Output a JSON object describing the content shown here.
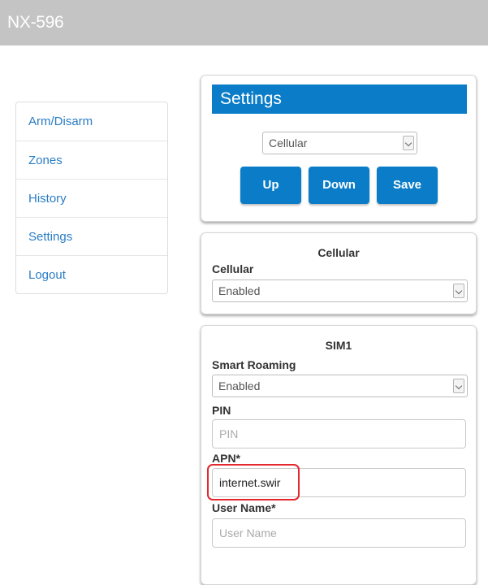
{
  "header": {
    "title": "NX-596"
  },
  "nav": {
    "items": [
      {
        "label": "Arm/Disarm"
      },
      {
        "label": "Zones"
      },
      {
        "label": "History"
      },
      {
        "label": "Settings"
      },
      {
        "label": "Logout"
      }
    ]
  },
  "settings": {
    "title": "Settings",
    "selected": "Cellular",
    "buttons": {
      "up": "Up",
      "down": "Down",
      "save": "Save"
    }
  },
  "cellular": {
    "title": "Cellular",
    "field_label": "Cellular",
    "value": "Enabled"
  },
  "sim1": {
    "title": "SIM1",
    "smart_roaming": {
      "label": "Smart Roaming",
      "value": "Enabled"
    },
    "pin": {
      "label": "PIN",
      "placeholder": "PIN"
    },
    "apn": {
      "label": "APN*",
      "value": "internet.swir"
    },
    "user_name": {
      "label": "User Name*",
      "placeholder": "User Name"
    }
  },
  "colors": {
    "accent": "#0b7dc8",
    "header_bg": "#c4c4c4",
    "link": "#2a7cc4",
    "highlight": "#e4262d"
  }
}
